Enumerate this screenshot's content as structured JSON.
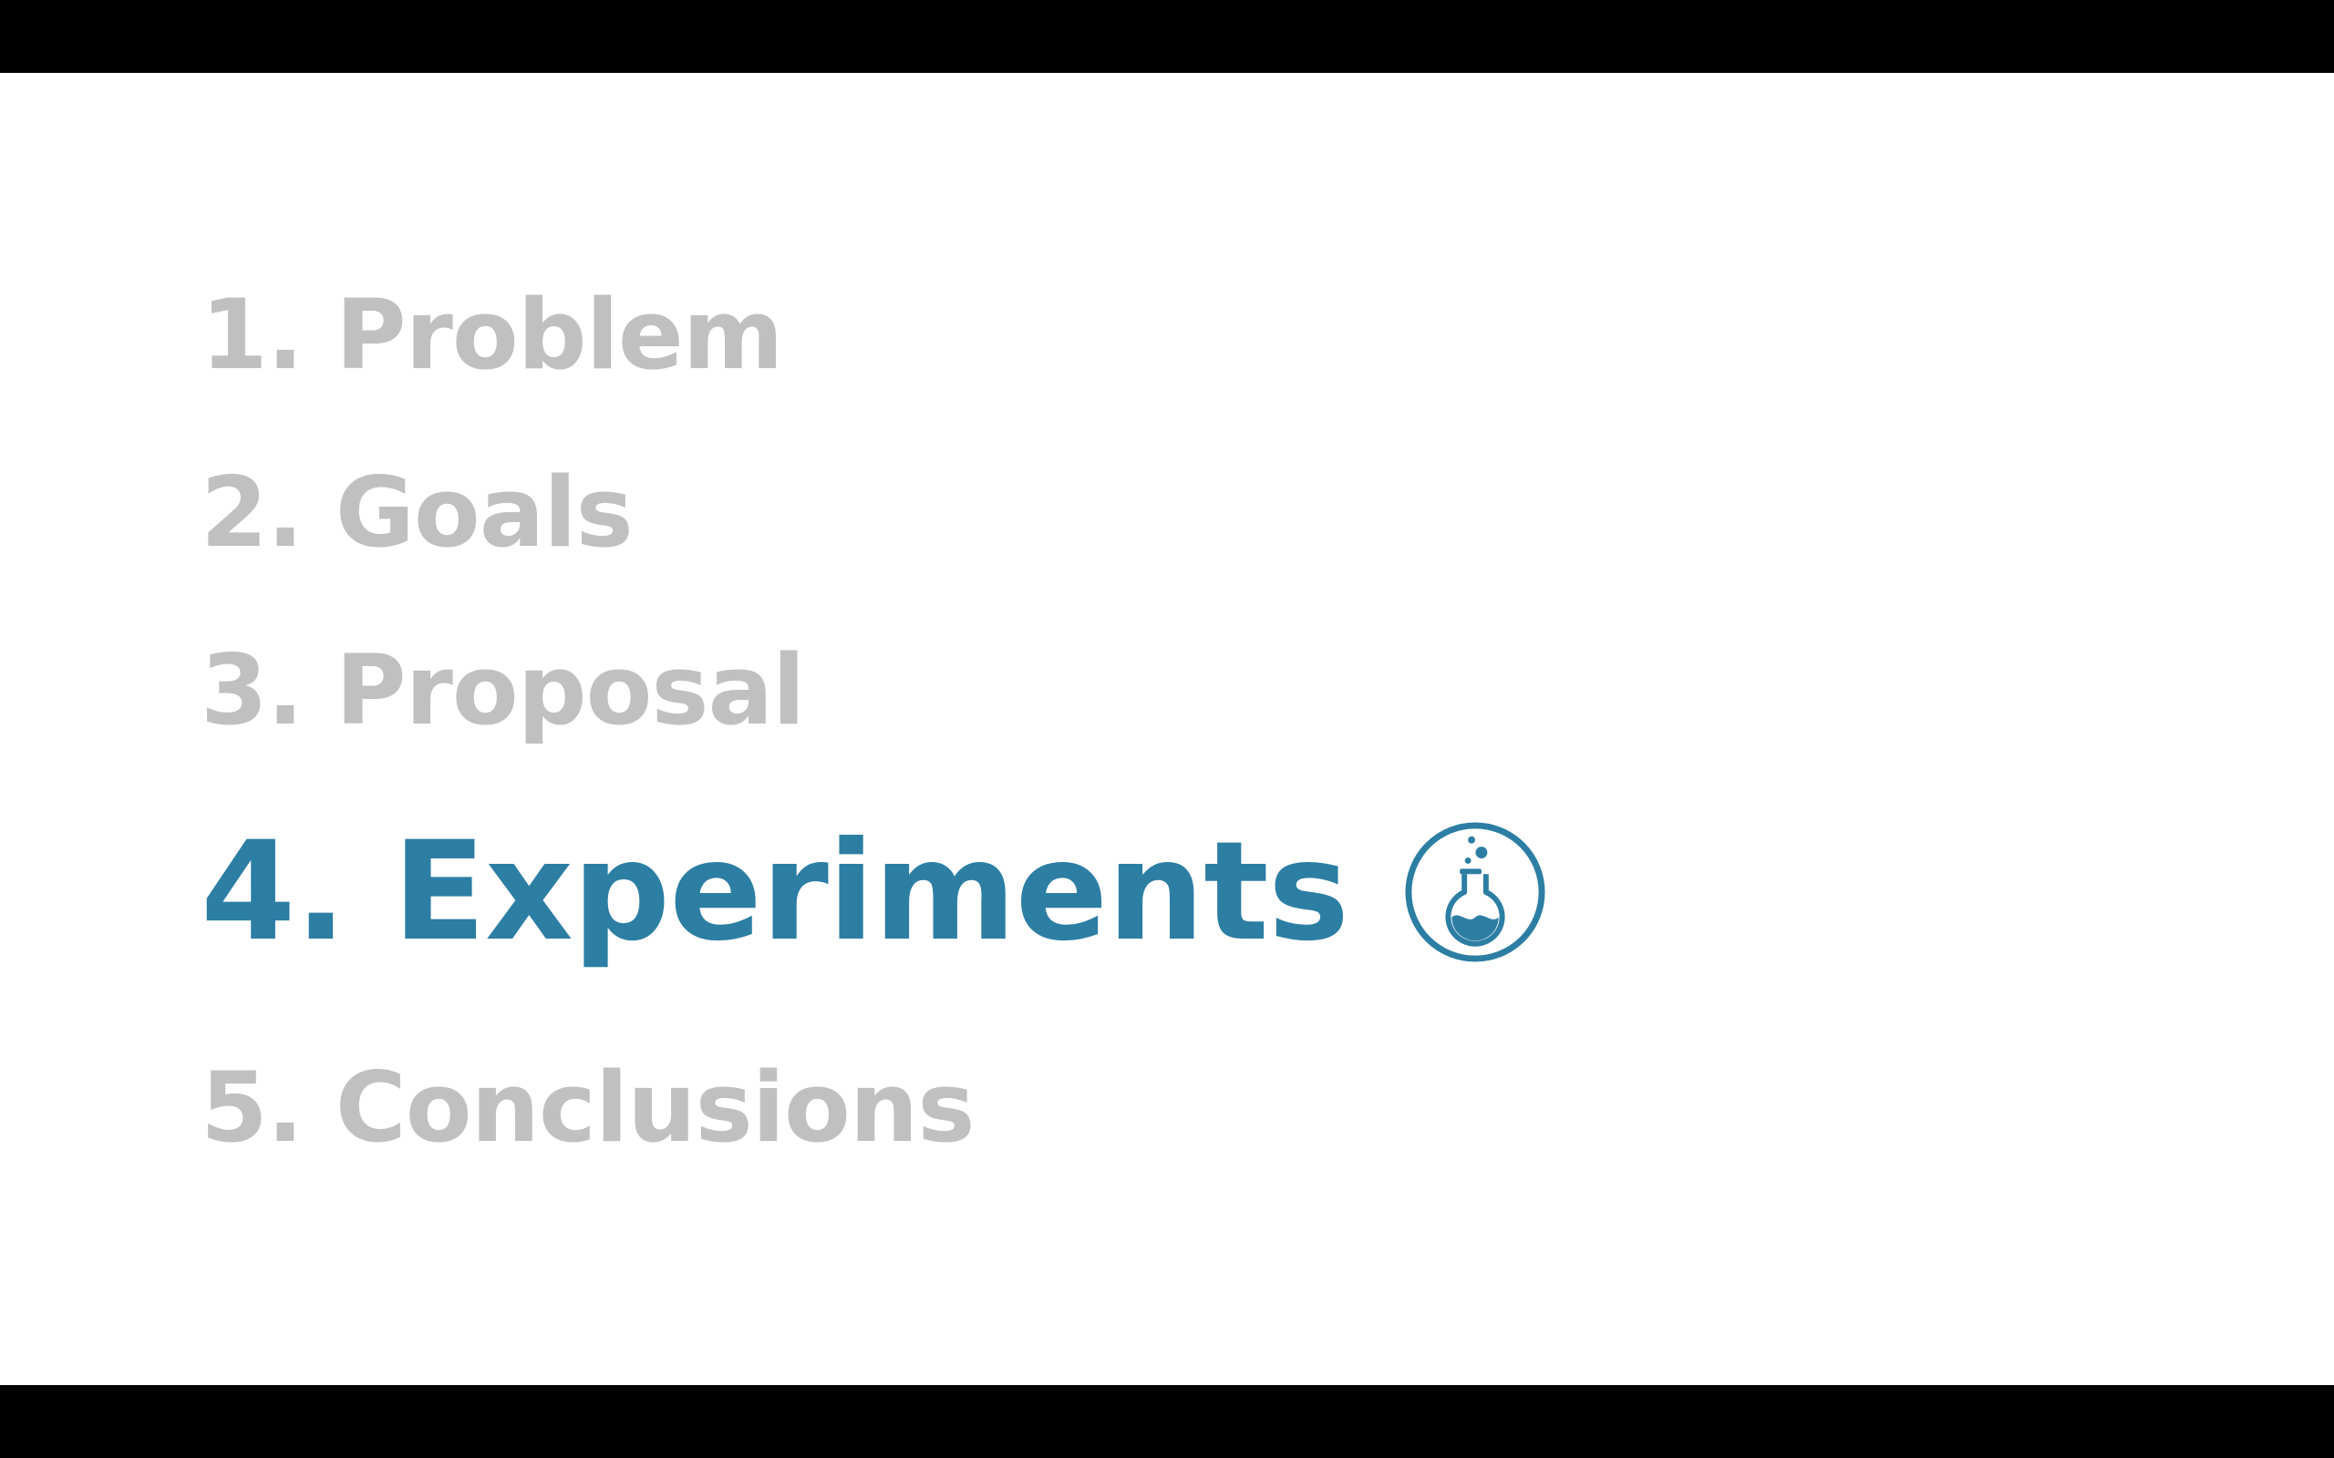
{
  "colors": {
    "background": "#ffffff",
    "letterbox": "#000000",
    "inactive_text": "#c0c0c0",
    "active_accent": "#2c7ea3"
  },
  "agenda": {
    "items": [
      {
        "label": "1. Problem",
        "active": false
      },
      {
        "label": "2. Goals",
        "active": false
      },
      {
        "label": "3. Proposal",
        "active": false
      },
      {
        "label": "4. Experiments",
        "active": true,
        "icon": "flask-icon"
      },
      {
        "label": "5. Conclusions",
        "active": false
      }
    ]
  }
}
